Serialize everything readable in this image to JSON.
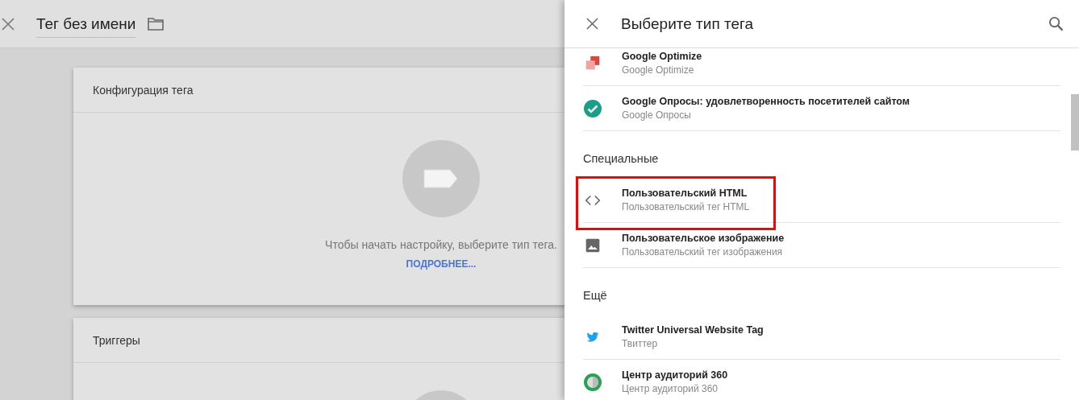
{
  "editor": {
    "title": "Тег без имени",
    "cards": [
      {
        "title": "Конфигурация тега",
        "hint": "Чтобы начать настройку, выберите тип тега.",
        "link": "ПОДРОБНЕЕ..."
      },
      {
        "title": "Триггеры"
      }
    ]
  },
  "panel": {
    "title": "Выберите тип тега",
    "entries": [
      {
        "kind": "item",
        "title": "Google Optimize",
        "subtitle": "Google Optimize",
        "highlighted": false
      },
      {
        "kind": "item",
        "title": "Google Опросы: удовлетворенность посетителей сайтом",
        "subtitle": "Google Опросы",
        "highlighted": false
      },
      {
        "kind": "section",
        "label": "Специальные"
      },
      {
        "kind": "item",
        "title": "Пользовательский HTML",
        "subtitle": "Пользовательский тег HTML",
        "highlighted": true
      },
      {
        "kind": "item",
        "title": "Пользовательское изображение",
        "subtitle": "Пользовательский тег изображения",
        "highlighted": false
      },
      {
        "kind": "section",
        "label": "Ещё"
      },
      {
        "kind": "item",
        "title": "Twitter Universal Website Tag",
        "subtitle": "Твиттер",
        "highlighted": false
      },
      {
        "kind": "item",
        "title": "Центр аудиторий 360",
        "subtitle": "Центр аудиторий 360",
        "highlighted": false
      }
    ]
  }
}
